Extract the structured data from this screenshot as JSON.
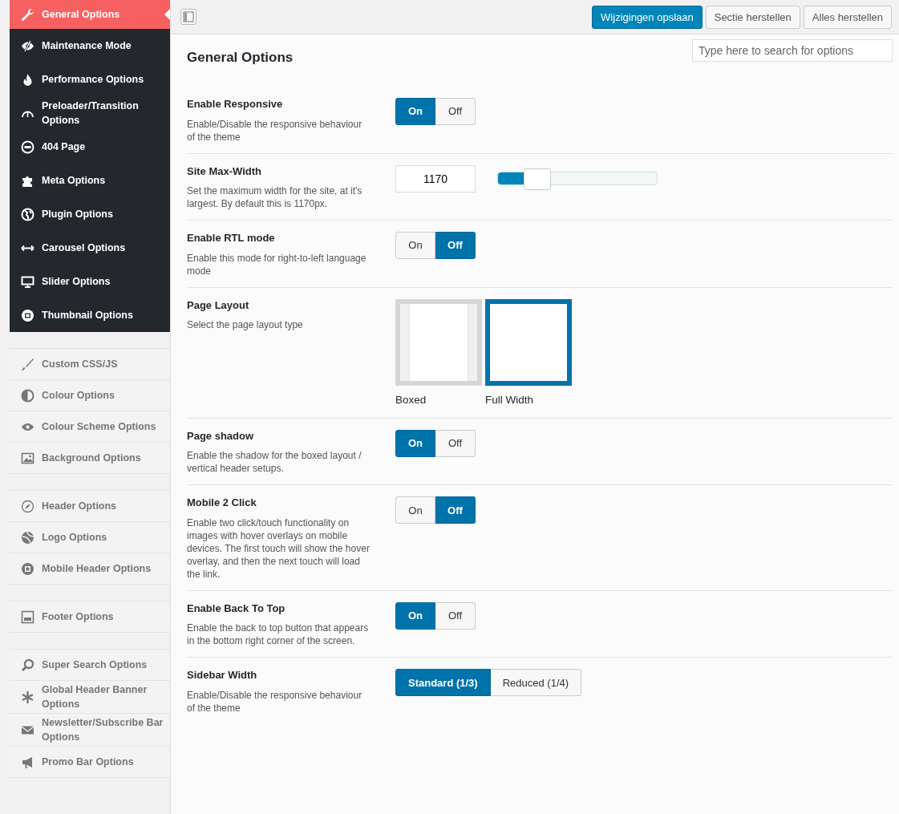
{
  "sidebar": {
    "groups": [
      {
        "kind": "dark",
        "items": [
          {
            "label": "General Options",
            "selected": true
          },
          {
            "label": "Maintenance Mode",
            "selected": false
          },
          {
            "label": "Performance Options",
            "selected": false
          },
          {
            "label": "Preloader/Transition Options",
            "selected": false
          },
          {
            "label": "404 Page",
            "selected": false
          },
          {
            "label": "Meta Options",
            "selected": false
          },
          {
            "label": "Plugin Options",
            "selected": false
          },
          {
            "label": "Carousel Options",
            "selected": false
          },
          {
            "label": "Slider Options",
            "selected": false
          },
          {
            "label": "Thumbnail Options",
            "selected": false
          }
        ]
      },
      {
        "kind": "light",
        "items": [
          {
            "label": "Custom CSS/JS",
            "selected": false
          },
          {
            "label": "Colour Options",
            "selected": false
          },
          {
            "label": "Colour Scheme Options",
            "selected": false
          },
          {
            "label": "Background Options",
            "selected": false
          }
        ]
      },
      {
        "kind": "light",
        "items": [
          {
            "label": "Header Options",
            "selected": false
          },
          {
            "label": "Logo Options",
            "selected": false
          },
          {
            "label": "Mobile Header Options",
            "selected": false
          }
        ]
      },
      {
        "kind": "light",
        "items": [
          {
            "label": "Footer Options",
            "selected": false
          }
        ]
      },
      {
        "kind": "light",
        "items": [
          {
            "label": "Super Search Options",
            "selected": false
          },
          {
            "label": "Global Header Banner Options",
            "selected": false
          },
          {
            "label": "Newsletter/Subscribe Bar Options",
            "selected": false
          },
          {
            "label": "Promo Bar Options",
            "selected": false
          }
        ]
      }
    ]
  },
  "toolbar": {
    "buttons": [
      {
        "label": "Wijzigingen opslaan",
        "kind": "primary"
      },
      {
        "label": "Sectie herstellen",
        "kind": "secondary"
      },
      {
        "label": "Alles herstellen",
        "kind": "secondary"
      }
    ]
  },
  "section": {
    "title": "General Options",
    "search": {
      "placeholder": "Type here to search for options"
    }
  },
  "options": [
    {
      "kind": "toggle",
      "title": "Enable Responsive",
      "description": "Enable/Disable the responsive behaviour of the theme",
      "choices": [
        {
          "label": "On",
          "selected": true
        },
        {
          "label": "Off",
          "selected": false
        }
      ]
    },
    {
      "kind": "slider",
      "title": "Site Max-Width",
      "description": "Set the maximum width for the site, at it's largest. By default this is 1170px.",
      "value": "1170",
      "level": 0.17
    },
    {
      "kind": "toggle",
      "title": "Enable RTL mode",
      "description": "Enable this mode for right-to-left language mode",
      "choices": [
        {
          "label": "On",
          "selected": false
        },
        {
          "label": "Off",
          "selected": true
        }
      ]
    },
    {
      "kind": "layout",
      "title": "Page Layout",
      "description": "Select the page layout type",
      "choices": [
        {
          "label": "Boxed",
          "selected": false
        },
        {
          "label": "Full Width",
          "selected": true
        }
      ]
    },
    {
      "kind": "toggle",
      "title": "Page shadow",
      "description": "Enable the shadow for the boxed layout / vertical header setups.",
      "choices": [
        {
          "label": "On",
          "selected": true
        },
        {
          "label": "Off",
          "selected": false
        }
      ]
    },
    {
      "kind": "toggle",
      "title": "Mobile 2 Click",
      "description": "Enable two click/touch functionality on images with hover overlays on mobile devices. The first touch will show the hover overlay, and then the next touch will load the link.",
      "choices": [
        {
          "label": "On",
          "selected": false
        },
        {
          "label": "Off",
          "selected": true
        }
      ]
    },
    {
      "kind": "toggle",
      "title": "Enable Back To Top",
      "description": "Enable the back to top button that appears in the bottom right corner of the screen.",
      "choices": [
        {
          "label": "On",
          "selected": true
        },
        {
          "label": "Off",
          "selected": false
        }
      ]
    },
    {
      "kind": "toggle",
      "title": "Sidebar Width",
      "description": "Enable/Disable the responsive behaviour of the theme",
      "choices": [
        {
          "label": "Standard (1/3)",
          "selected": true
        },
        {
          "label": "Reduced (1/4)",
          "selected": false
        }
      ]
    }
  ]
}
